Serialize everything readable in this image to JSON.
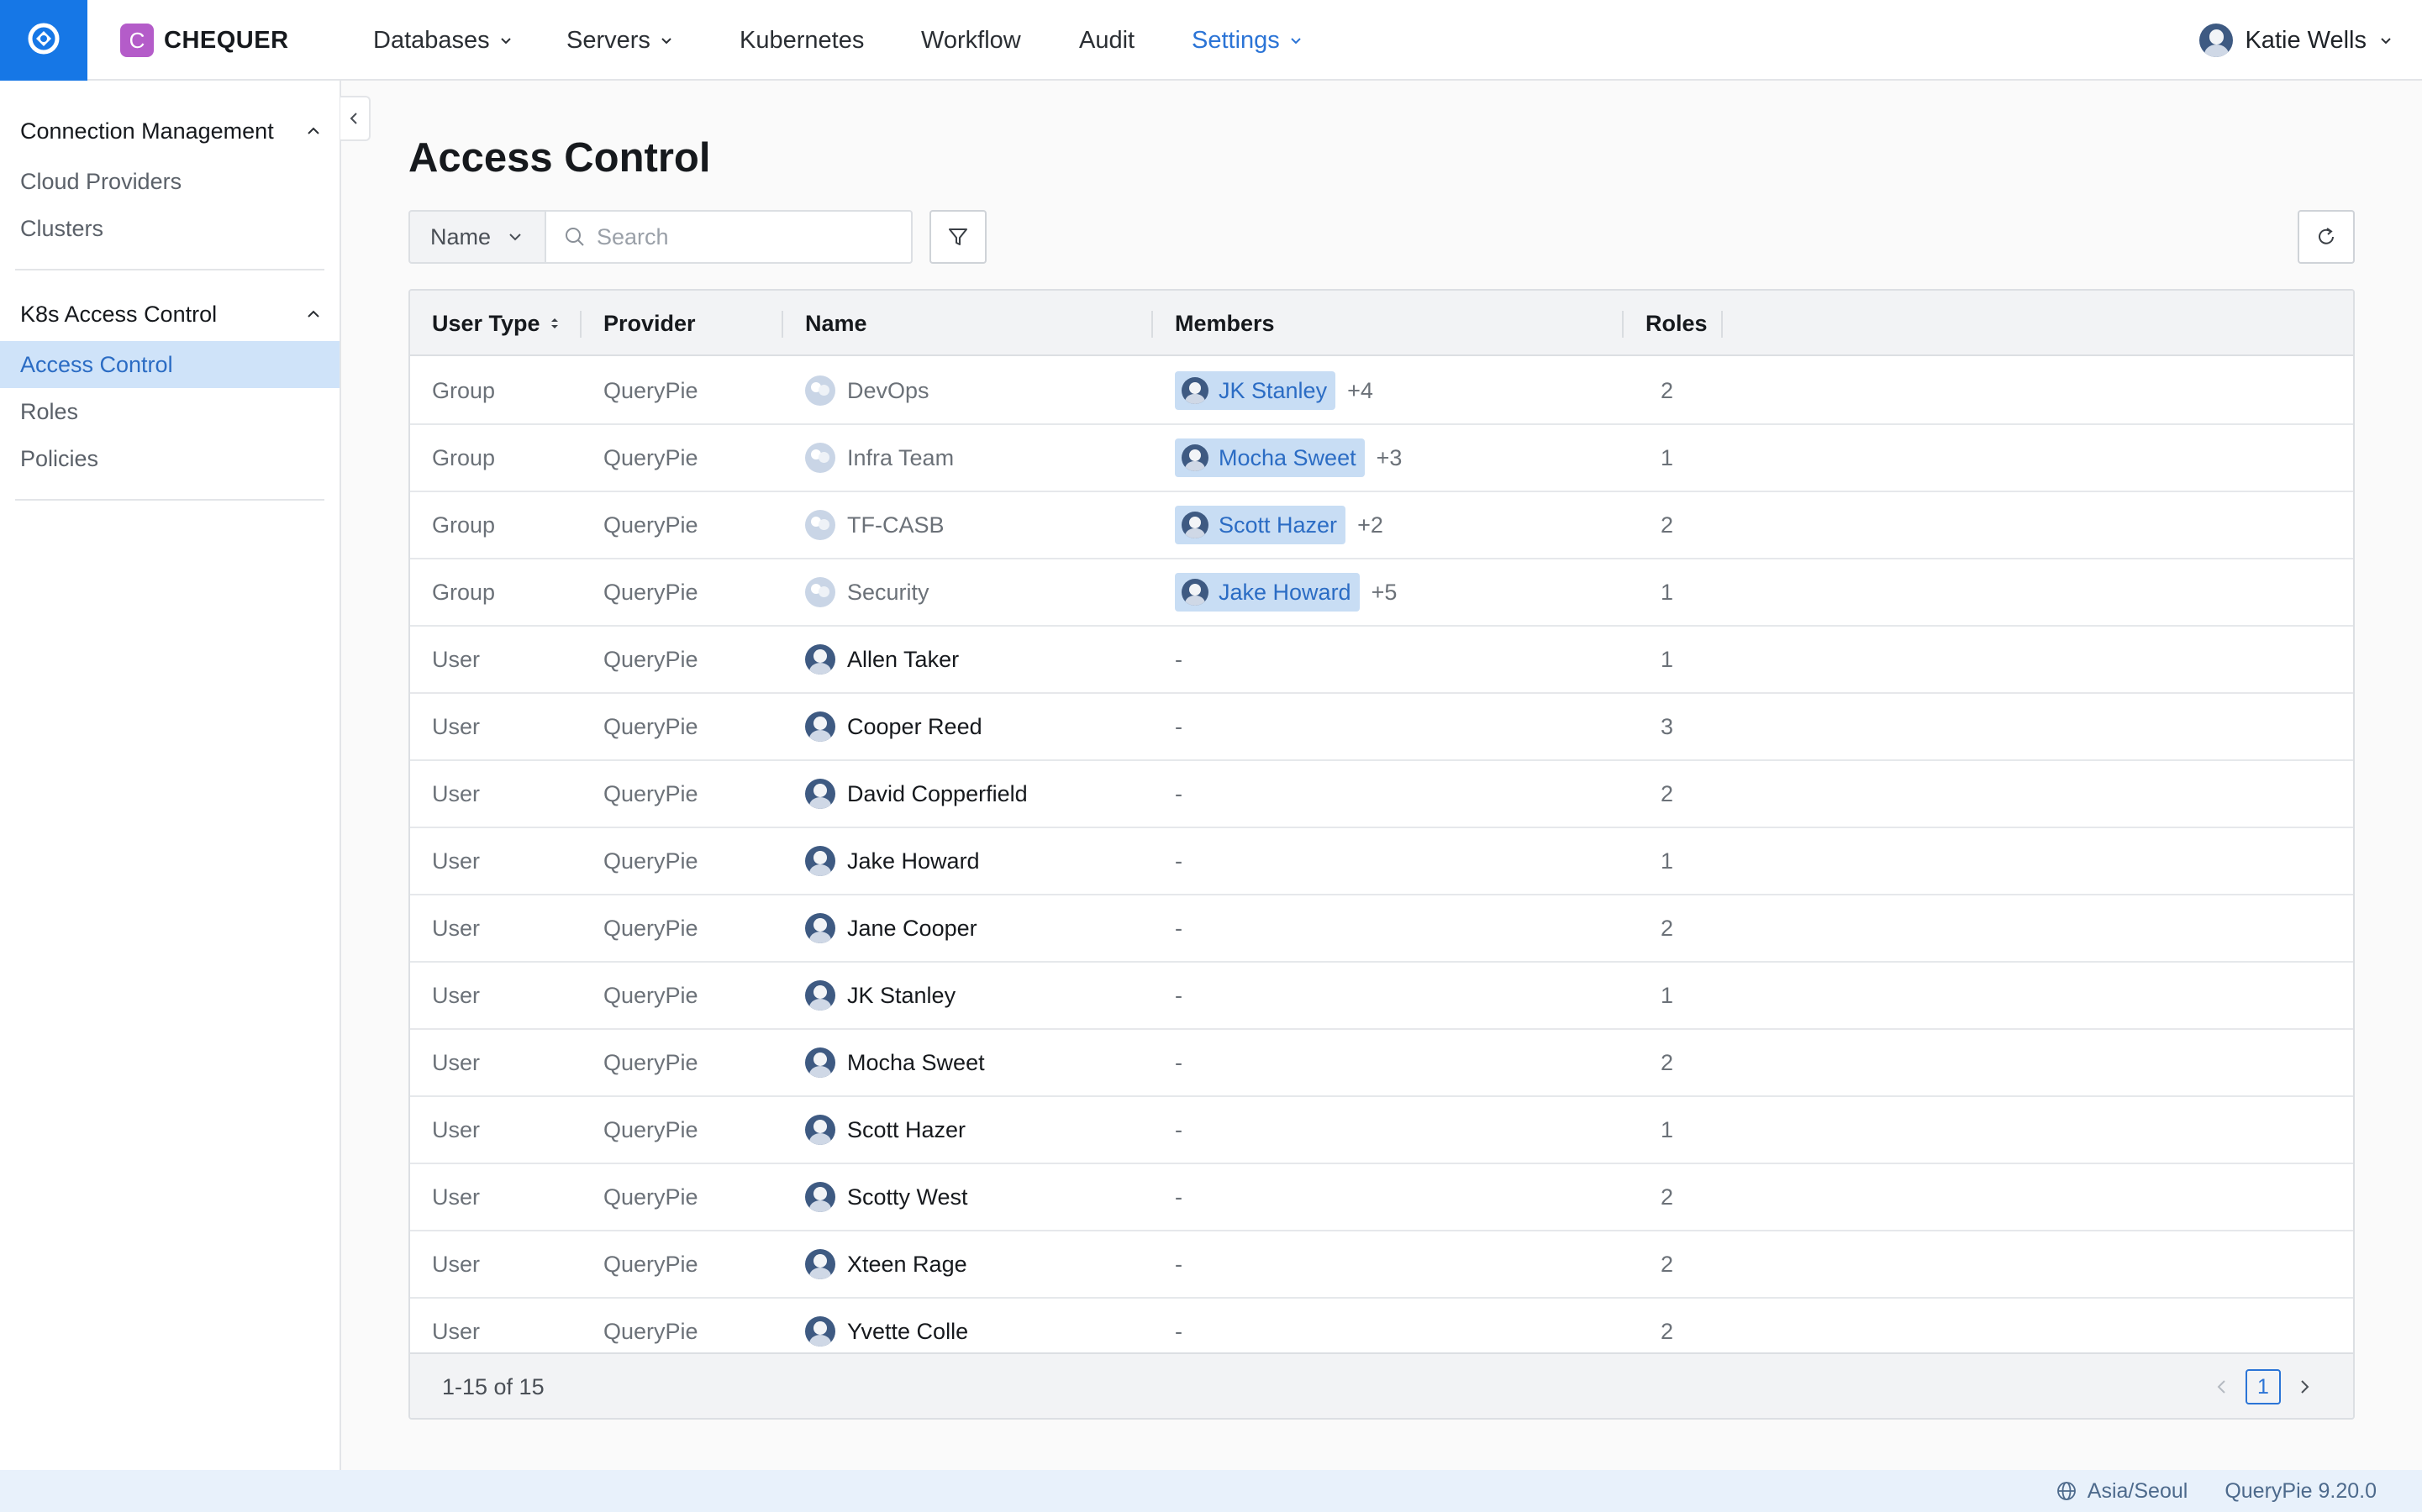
{
  "brand": {
    "badge": "C",
    "name": "CHEQUER"
  },
  "nav": [
    {
      "label": "Databases",
      "dropdown": true,
      "active": false
    },
    {
      "label": "Servers",
      "dropdown": true,
      "active": false
    },
    {
      "label": "Kubernetes",
      "dropdown": false,
      "active": false
    },
    {
      "label": "Workflow",
      "dropdown": false,
      "active": false
    },
    {
      "label": "Audit",
      "dropdown": false,
      "active": false
    },
    {
      "label": "Settings",
      "dropdown": true,
      "active": true
    }
  ],
  "user": {
    "name": "Katie Wells"
  },
  "sidebar": {
    "sections": [
      {
        "title": "Connection Management",
        "items": [
          "Cloud Providers",
          "Clusters"
        ]
      },
      {
        "title": "K8s Access Control",
        "items": [
          "Access Control",
          "Roles",
          "Policies"
        ],
        "active_item": "Access Control"
      }
    ]
  },
  "page": {
    "title": "Access Control"
  },
  "filter": {
    "field": "Name",
    "search_placeholder": "Search",
    "search_value": ""
  },
  "table": {
    "columns": [
      "User Type",
      "Provider",
      "Name",
      "Members",
      "Roles"
    ],
    "rows": [
      {
        "user_type": "Group",
        "provider": "QueryPie",
        "name": "DevOps",
        "member": "JK Stanley",
        "more": "+4",
        "roles": "2"
      },
      {
        "user_type": "Group",
        "provider": "QueryPie",
        "name": "Infra Team",
        "member": "Mocha Sweet",
        "more": "+3",
        "roles": "1"
      },
      {
        "user_type": "Group",
        "provider": "QueryPie",
        "name": "TF-CASB",
        "member": "Scott Hazer",
        "more": "+2",
        "roles": "2"
      },
      {
        "user_type": "Group",
        "provider": "QueryPie",
        "name": "Security",
        "member": "Jake Howard",
        "more": "+5",
        "roles": "1"
      },
      {
        "user_type": "User",
        "provider": "QueryPie",
        "name": "Allen Taker",
        "member": "-",
        "more": "",
        "roles": "1"
      },
      {
        "user_type": "User",
        "provider": "QueryPie",
        "name": "Cooper Reed",
        "member": "-",
        "more": "",
        "roles": "3"
      },
      {
        "user_type": "User",
        "provider": "QueryPie",
        "name": "David Copperfield",
        "member": "-",
        "more": "",
        "roles": "2"
      },
      {
        "user_type": "User",
        "provider": "QueryPie",
        "name": "Jake Howard",
        "member": "-",
        "more": "",
        "roles": "1"
      },
      {
        "user_type": "User",
        "provider": "QueryPie",
        "name": "Jane Cooper",
        "member": "-",
        "more": "",
        "roles": "2"
      },
      {
        "user_type": "User",
        "provider": "QueryPie",
        "name": "JK Stanley",
        "member": "-",
        "more": "",
        "roles": "1"
      },
      {
        "user_type": "User",
        "provider": "QueryPie",
        "name": "Mocha Sweet",
        "member": "-",
        "more": "",
        "roles": "2"
      },
      {
        "user_type": "User",
        "provider": "QueryPie",
        "name": "Scott Hazer",
        "member": "-",
        "more": "",
        "roles": "1"
      },
      {
        "user_type": "User",
        "provider": "QueryPie",
        "name": "Scotty West",
        "member": "-",
        "more": "",
        "roles": "2"
      },
      {
        "user_type": "User",
        "provider": "QueryPie",
        "name": "Xteen Rage",
        "member": "-",
        "more": "",
        "roles": "2"
      },
      {
        "user_type": "User",
        "provider": "QueryPie",
        "name": "Yvette Colle",
        "member": "-",
        "more": "",
        "roles": "2"
      }
    ]
  },
  "pagination": {
    "range": "1-15 of 15",
    "current_page": "1"
  },
  "footer": {
    "timezone": "Asia/Seoul",
    "version": "QueryPie 9.20.0"
  },
  "icons": {
    "home": "querypie-logo-icon",
    "filter": "filter-funnel-icon",
    "refresh": "refresh-icon",
    "search": "search-icon",
    "globe": "globe-icon"
  },
  "colors": {
    "accent": "#1677e6",
    "active_text": "#2b74d6",
    "sidebar_active_bg": "#cfe3f9",
    "member_chip_bg": "#c8ddf4",
    "brand_badge": "#b45cc9",
    "statusbar_bg": "#e8f1fb"
  }
}
